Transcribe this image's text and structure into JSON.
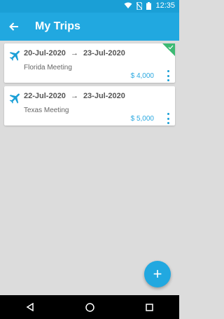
{
  "status_bar": {
    "time": "12:35",
    "icons": [
      "wifi-icon",
      "no-sim-icon",
      "battery-icon"
    ]
  },
  "app_bar": {
    "title": "My Trips",
    "back_icon": "arrow-left-icon"
  },
  "trips": [
    {
      "start_date": "20-Jul-2020",
      "arrow": "→",
      "end_date": "23-Jul-2020",
      "name": "Florida Meeting",
      "amount": "$ 4,000",
      "badge": "approved-check",
      "icon": "airplane-icon"
    },
    {
      "start_date": "22-Jul-2020",
      "arrow": "→",
      "end_date": "23-Jul-2020",
      "name": "Texas Meeting",
      "amount": "$ 5,000",
      "icon": "airplane-icon"
    }
  ],
  "fab": {
    "label": "+"
  },
  "colors": {
    "primary": "#21a8e0",
    "status": "#1a9fd6",
    "badge": "#3cba73",
    "background": "#dcdcdc"
  }
}
